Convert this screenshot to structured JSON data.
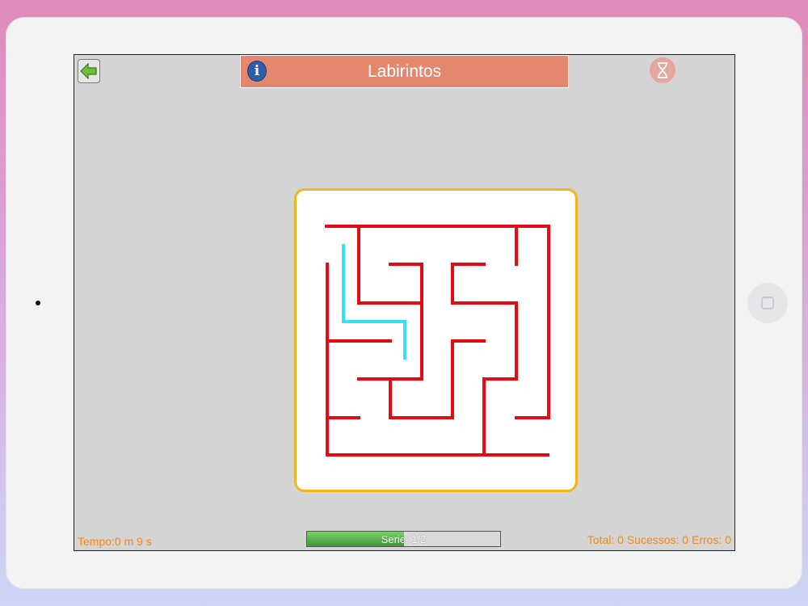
{
  "app": {
    "title": "Labirintos"
  },
  "icons": {
    "back": "back-arrow-icon",
    "info": "info-icon",
    "info_glyph": "i",
    "timer": "hourglass-icon"
  },
  "colors": {
    "title_bar": "#e3886f",
    "maze_walls": "#e60a14",
    "player_path": "#33e3ef",
    "card_border": "#f2b51d",
    "footer_text": "#ef8a1e",
    "progress_fill": "#4caf3f"
  },
  "footer": {
    "time": "Tempo:0 m 9 s",
    "series": "Serie: 1/2",
    "series_progress": 0.5,
    "stats": "Total: 0 Sucessos: 0 Erros: 0"
  }
}
